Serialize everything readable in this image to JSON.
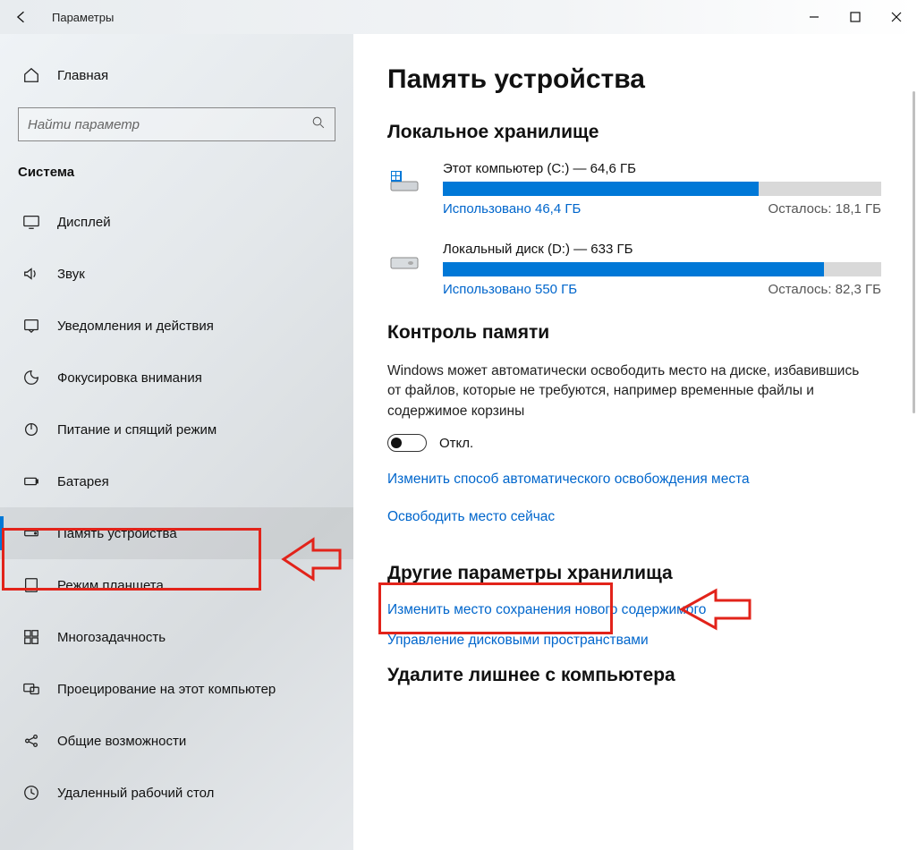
{
  "window": {
    "title": "Параметры"
  },
  "sidebar": {
    "home": "Главная",
    "search_placeholder": "Найти параметр",
    "category": "Система",
    "items": [
      {
        "label": "Дисплей",
        "icon": "display"
      },
      {
        "label": "Звук",
        "icon": "sound"
      },
      {
        "label": "Уведомления и действия",
        "icon": "notifications"
      },
      {
        "label": "Фокусировка внимания",
        "icon": "focus"
      },
      {
        "label": "Питание и спящий режим",
        "icon": "power"
      },
      {
        "label": "Батарея",
        "icon": "battery"
      },
      {
        "label": "Память устройства",
        "icon": "storage",
        "selected": true
      },
      {
        "label": "Режим планшета",
        "icon": "tablet"
      },
      {
        "label": "Многозадачность",
        "icon": "multitask"
      },
      {
        "label": "Проецирование на этот компьютер",
        "icon": "project"
      },
      {
        "label": "Общие возможности",
        "icon": "shared"
      },
      {
        "label": "Удаленный рабочий стол",
        "icon": "remote"
      }
    ]
  },
  "main": {
    "title": "Память устройства",
    "local_storage_heading": "Локальное хранилище",
    "drives": [
      {
        "name": "Этот компьютер (C:) — 64,6 ГБ",
        "used_label": "Использовано 46,4 ГБ",
        "free_label": "Осталось: 18,1 ГБ",
        "used_pct": 72,
        "icon": "system-drive"
      },
      {
        "name": "Локальный диск (D:) — 633 ГБ",
        "used_label": "Использовано 550 ГБ",
        "free_label": "Осталось: 82,3 ГБ",
        "used_pct": 87,
        "icon": "hdd-drive"
      }
    ],
    "sense_heading": "Контроль памяти",
    "sense_desc": "Windows может автоматически освободить место на диске, избавившись от файлов, которые не требуются, например временные файлы и содержимое корзины",
    "toggle_state": "Откл.",
    "link_change_auto": "Изменить способ автоматического освобождения места",
    "link_free_now": "Освободить место сейчас",
    "other_heading": "Другие параметры хранилища",
    "link_change_save": "Изменить место сохранения нового содержимого",
    "link_manage_spaces": "Управление дисковыми пространствами",
    "delete_heading": "Удалите лишнее с компьютера"
  }
}
